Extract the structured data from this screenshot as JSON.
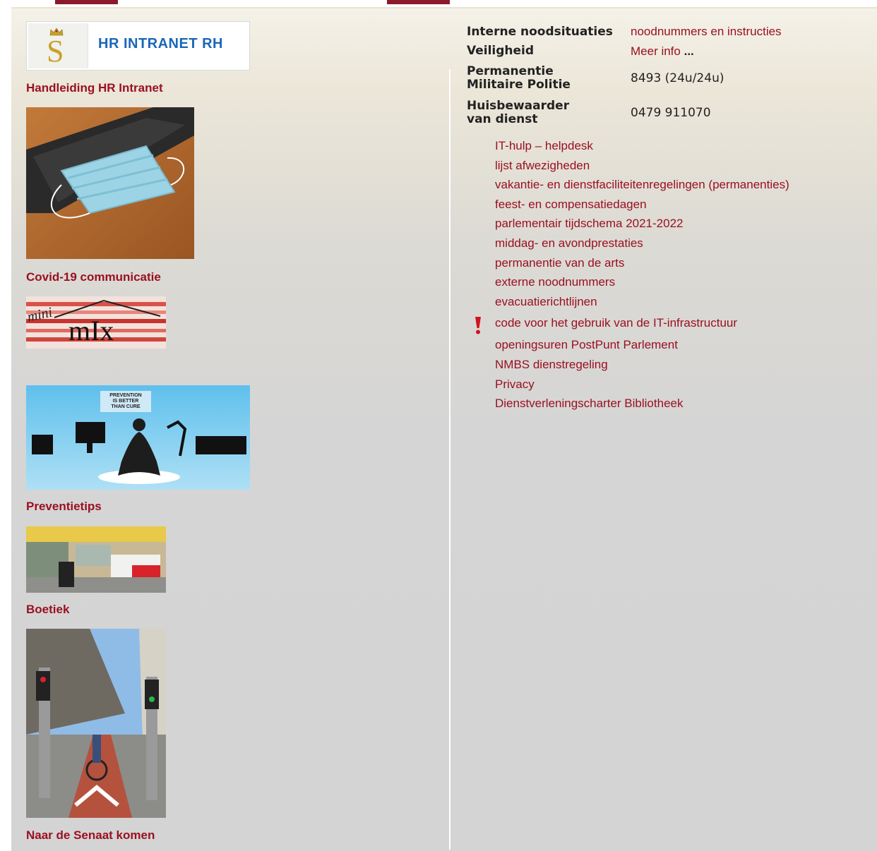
{
  "logo": {
    "text": "HR INTRANET RH",
    "emblem_letter": "S"
  },
  "left_column": {
    "manual_link": "Handleiding HR Intranet",
    "covid_link": "Covid-19 communicatie",
    "minimix_alt": "mini mIx",
    "prevention_caption": "PREVENTION IS BETTER THAN CURE",
    "prevention_link": "Preventietips",
    "boetiek_link": "Boetiek",
    "senate_link": "Naar de Senaat komen"
  },
  "info_table": [
    {
      "label": "Interne noodsituaties",
      "value": "noodnummers en instructies",
      "is_link": true
    },
    {
      "label": "Veiligheid",
      "value": "Meer info",
      "suffix": "...",
      "is_link": true
    },
    {
      "label_line1": "Permanentie",
      "label_line2": "Militaire Politie",
      "value": "8493 (24u/24u)",
      "is_link": false
    },
    {
      "label_line1": "Huisbewaarder",
      "label_line2": "van dienst",
      "value": "0479 911070",
      "is_link": false
    }
  ],
  "links": [
    "IT-hulp – helpdesk",
    "lijst afwezigheden",
    "vakantie- en dienstfaciliteitenregelingen (permanenties)",
    "feest- en compensatiedagen",
    "parlementair tijdschema 2021-2022",
    "middag- en avondprestaties",
    "permanentie van de arts",
    "externe noodnummers",
    "evacuatierichtlijnen",
    "code voor het gebruik van de IT-infrastructuur",
    "openingsuren PostPunt Parlement",
    "NMBS dienstregeling",
    "Privacy",
    "Dienstverleningscharter Bibliotheek"
  ],
  "colors": {
    "accent": "#9a1021",
    "background": "#d4d4d4",
    "logo_text": "#1a66b8"
  },
  "icons": {
    "alert": "exclamation-icon"
  }
}
